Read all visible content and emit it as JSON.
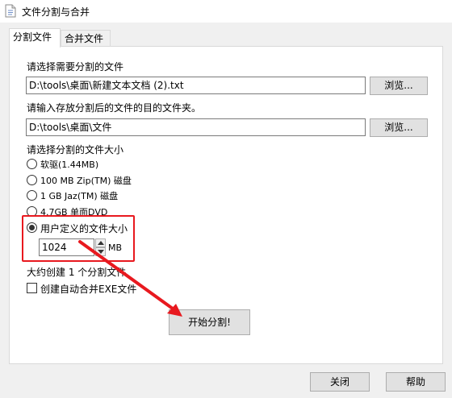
{
  "window": {
    "title": "文件分割与合并"
  },
  "tabs": [
    {
      "label": "分割文件",
      "active": true
    },
    {
      "label": "合并文件",
      "active": false
    }
  ],
  "split": {
    "source_label": "请选择需要分割的文件",
    "source_value": "D:\\tools\\桌面\\新建文本文档 (2).txt",
    "browse_label": "浏览...",
    "dest_label": "请输入存放分割后的文件的目的文件夹。",
    "dest_value": "D:\\tools\\桌面\\文件",
    "size_label": "请选择分割的文件大小",
    "size_options": [
      {
        "label": "软驱(1.44MB)",
        "selected": false
      },
      {
        "label": "100 MB Zip(TM) 磁盘",
        "selected": false
      },
      {
        "label": "1 GB Jaz(TM) 磁盘",
        "selected": false
      },
      {
        "label": "4.7GB 单面DVD",
        "selected": false
      },
      {
        "label": "用户定义的文件大小",
        "selected": true
      }
    ],
    "custom_size_value": "1024",
    "custom_size_unit": "MB",
    "estimate_text": "大约创建 1 个分割文件",
    "create_exe_label": "创建自动合并EXE文件",
    "create_exe_checked": false,
    "start_label": "开始分割!"
  },
  "footer": {
    "close_label": "关闭",
    "help_label": "帮助"
  },
  "annotation_color": "#e8191f",
  "icons": [
    "file-icon",
    "spin-up-icon",
    "spin-down-icon",
    "arrow-icon"
  ]
}
